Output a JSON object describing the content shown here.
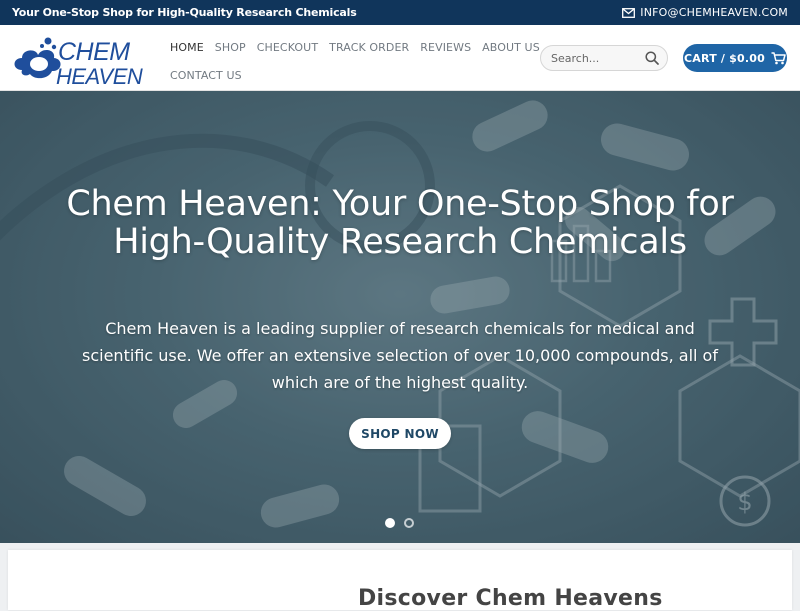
{
  "topbar": {
    "tagline": "Your One-Stop Shop for High-Quality Research Chemicals",
    "email": "INFO@CHEMHEAVEN.COM",
    "email_icon": "mail-icon"
  },
  "logo": {
    "line1": "CHEM",
    "line2": "HEAVEN",
    "color": "#1f4e9c"
  },
  "nav": {
    "items": [
      {
        "label": "HOME",
        "active": true
      },
      {
        "label": "SHOP"
      },
      {
        "label": "CHECKOUT"
      },
      {
        "label": "TRACK ORDER"
      },
      {
        "label": "REVIEWS"
      },
      {
        "label": "ABOUT US"
      },
      {
        "label": "CONTACT US"
      }
    ]
  },
  "search": {
    "placeholder": "Search...",
    "icon": "search-icon"
  },
  "cart": {
    "label": "CART / $0.00",
    "icon": "cart-icon",
    "color": "#1f65a6"
  },
  "hero": {
    "title": "Chem Heaven: Your One-Stop Shop for High-Quality Research Chemicals",
    "text": "Chem Heaven is a leading supplier of research chemicals for medical and scientific use. We offer an extensive selection of over 10,000 compounds, all of which are of the highest quality.",
    "button": "SHOP NOW",
    "slide_count": 2,
    "active_slide": 1
  },
  "section": {
    "title": "Discover Chem Heavens"
  },
  "colors": {
    "topbar": "#10355b",
    "accent": "#1f65a6"
  }
}
